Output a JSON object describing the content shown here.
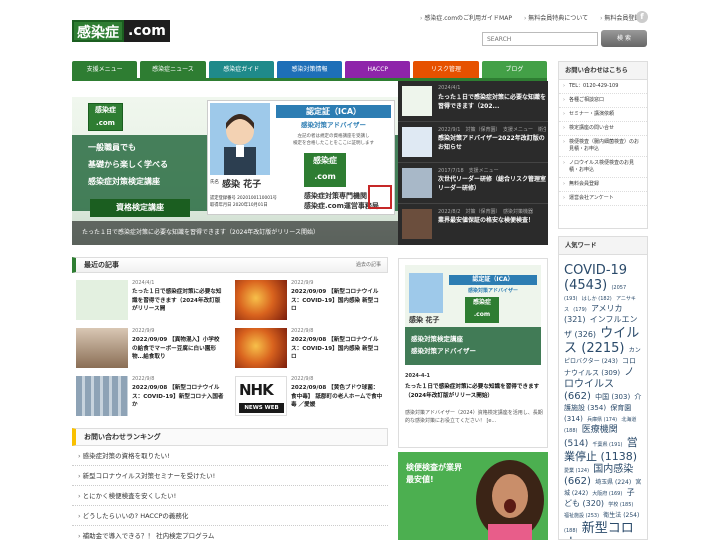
{
  "header": {
    "logo_a": "感染症",
    "logo_b": ".com",
    "links": [
      "感染症.comのご利用ガイドMAP",
      "無料会員特典について",
      "無料会員登録"
    ],
    "facebook": "f",
    "search_placeholder": "SEARCH",
    "search_button": "検 索"
  },
  "nav": {
    "tabs": [
      {
        "label": "支援メニュー",
        "color": "#2e7d32"
      },
      {
        "label": "感染症ニュース",
        "color": "#2e7d32"
      },
      {
        "label": "感染症ガイド",
        "color": "#1f8a8a"
      },
      {
        "label": "感染対策情報",
        "color": "#1e6fb8"
      },
      {
        "label": "HACCP",
        "color": "#8e24aa"
      },
      {
        "label": "リスク管理",
        "color": "#e65100"
      },
      {
        "label": "ブログ",
        "color": "#43a047"
      }
    ]
  },
  "hero": {
    "badge_a": "感染症",
    "badge_b": ".com",
    "line1": "一般職員でも",
    "line2": "基礎から楽しく学べる",
    "line3": "感染症対策検定講座",
    "button": "資格検定講座",
    "cert_title": "認定証（ICA）",
    "cert_sub": "感染対策アドバイザー",
    "cert_body1": "左記の者は規定の資格講座を受講し",
    "cert_body2": "検定を合格したことをここに証明します",
    "cert_name_label": "氏名",
    "cert_name": "感染 花子",
    "cert_no1": "認定登録番号 2020100110001号",
    "cert_no2": "取得年月日 2020年10月01日",
    "cert_org1": "感染症対策専門機関",
    "cert_org2": "感染症.com運営事務局",
    "caption": "たった１日で感染症対策に必要な知識を習得できます（2024年改訂版がリリース開始）"
  },
  "slider": [
    {
      "meta": "2024/4/1",
      "title": "たった１日で感染症対策に必要な知識を習得できます（202..."
    },
    {
      "meta": "2022/9/1　対策（保育園）　支援メニュー　衛生管理　感染予防対策",
      "title": "感染対策アドバイザー2022年改訂版のお知らせ"
    },
    {
      "meta": "2017/7/18　支援メニュー",
      "title": "次世代リーダー研修（総合リスク管理室リーダー研修）"
    },
    {
      "meta": "2022/8/2　対策（保育園）　感染対策機器",
      "title": "業界最安値保証の格安な検便検査！"
    }
  ],
  "latest": {
    "title": "最近の記事",
    "more": "過去の記事",
    "items": [
      {
        "date": "2024/4/1",
        "text": "たった１日で感染症対策に必要な知識を習得できます（2024年改訂版がリリース開"
      },
      {
        "date": "2022/9/9",
        "text": "2022/09/09 【新型コロナウイルス：COVID-19】国内感染 新型コロ"
      },
      {
        "date": "2022/9/9",
        "text": "2022/09/09 【異物混入】小学校の給食でマーボー豆腐に白い園形物…給食取り"
      },
      {
        "date": "2022/9/8",
        "text": "2022/09/08 【新型コロナウイルス：COVID-19】国内感染 新型コロ"
      },
      {
        "date": "2022/9/8",
        "text": "2022/09/08 【新型コロナウイルス：COVID-19】新型コロナ入国者か"
      },
      {
        "date": "2022/9/8",
        "text": "2022/09/08 【黄色ブドウ球菌：食中毒】 舐郡町の老人ホームで食中毒 ／愛媛"
      }
    ],
    "nhk_a": "NHK",
    "nhk_b": "NEWS WEB"
  },
  "ranking": {
    "title": "お問い合わせランキング",
    "items": [
      "感染症対策の資格を取りたい!",
      "新型コロナウイルス対策セミナーを受けたい!",
      "とにかく検便検査を安くしたい!",
      "どうしたらいいの? HACCPの義務化",
      "補助金で導入できる？！ 社内検定プログラム"
    ]
  },
  "featured": {
    "cert_title": "認定証（ICA）",
    "cert_sub": "感染対策アドバイザー",
    "cert_name": "感染 花子",
    "badge_a": "感染症",
    "badge_b": ".com",
    "band_a": "感染対策検定講座",
    "band_b": "感染対策アドバイザー",
    "date": "2024-4-1",
    "title": "たった１日で感染症対策に必要な知識を習得できます（2024年改訂版がリリース開始）",
    "excerpt": "感染対策アドバイザー（2024）資格検定講座を活用し、長期的な感染対策にお役立てください！ [e..."
  },
  "ad": {
    "text": "検便検査が業界最安値!"
  },
  "contact": {
    "title": "お問い合わせはこちら",
    "items": [
      "TEL：0120-429-109",
      "各種ご相談窓口",
      "セミナー・講演依頼",
      "検定講座の問い合せ",
      "検便検査（腸内細菌検査）のお見積・お申込",
      "ノロウイルス検便検査のお見積・お申込",
      "無料会員登録",
      "運営会社アンケート"
    ]
  },
  "words": {
    "title": "人気ワード",
    "cloud": [
      {
        "w": "COVID-19",
        "s": 13
      },
      {
        "w": "(4543)",
        "s": 13
      },
      {
        "w": "(2057 (193)",
        "s": 5
      },
      {
        "w": "はしか (182)",
        "s": 5
      },
      {
        "w": "アニサキス",
        "s": 5
      },
      {
        "w": "(179)",
        "s": 5
      },
      {
        "w": "アメリカ (321)",
        "s": 8
      },
      {
        "w": "インフルエンザ (326)",
        "s": 8
      },
      {
        "w": "ウイルス",
        "s": 13
      },
      {
        "w": "(2215)",
        "s": 13
      },
      {
        "w": "カンピロバクター (243)",
        "s": 6
      },
      {
        "w": "コロナウイルス (309)",
        "s": 7
      },
      {
        "w": "ノロウイルス (662)",
        "s": 10
      },
      {
        "w": "中国 (303)",
        "s": 7
      },
      {
        "w": "介護施設 (354)",
        "s": 7
      },
      {
        "w": "保育園 (314)",
        "s": 7
      },
      {
        "w": "兵庫県 (174)",
        "s": 5
      },
      {
        "w": "北海道 (188)",
        "s": 5
      },
      {
        "w": "医療機関 (514)",
        "s": 9
      },
      {
        "w": "千葉県 (191)",
        "s": 5
      },
      {
        "w": "営業停止 (1138)",
        "s": 11
      },
      {
        "w": "愛業 (124)",
        "s": 5
      },
      {
        "w": "国内感染 (662)",
        "s": 10
      },
      {
        "w": "埼玉県 (224)",
        "s": 6
      },
      {
        "w": "宮城 (242)",
        "s": 6
      },
      {
        "w": "大阪府 (169)",
        "s": 5
      },
      {
        "w": "子ども (320)",
        "s": 8
      },
      {
        "w": "学校 (185)",
        "s": 5
      },
      {
        "w": "福祉施設 (253)",
        "s": 5
      },
      {
        "w": "衛生法 (254)",
        "s": 6
      },
      {
        "w": "(188)",
        "s": 5
      },
      {
        "w": "新型コロナ",
        "s": 13
      }
    ]
  }
}
